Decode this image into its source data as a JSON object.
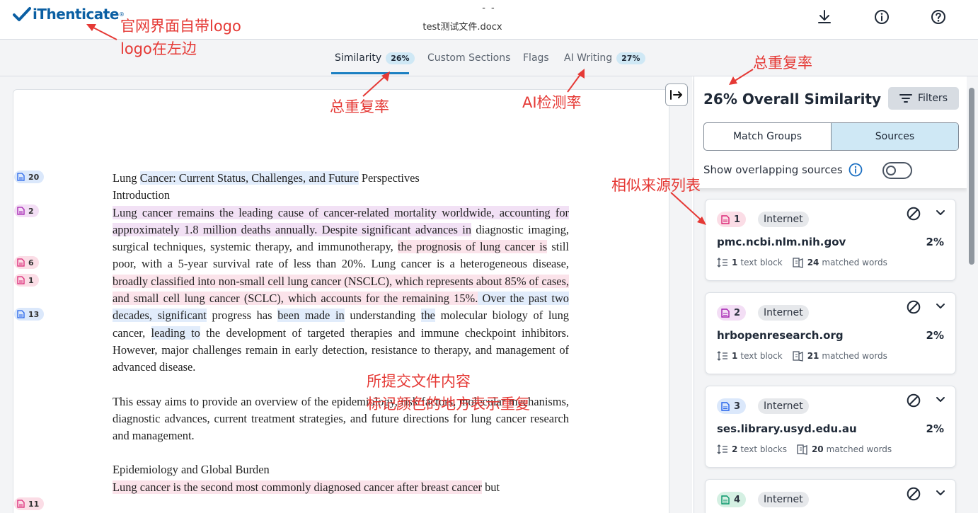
{
  "header": {
    "brand": "iThenticate",
    "doc_dashes": "- -",
    "doc_name": "test测试文件.docx",
    "icons": [
      "download-icon",
      "info-icon",
      "help-icon"
    ]
  },
  "tabs": [
    {
      "label": "Similarity",
      "badge": "26%",
      "active": true
    },
    {
      "label": "Custom Sections"
    },
    {
      "label": "Flags"
    },
    {
      "label": "AI Writing",
      "badge": "27%"
    }
  ],
  "document": {
    "markers": [
      "20",
      "2",
      "6",
      "1",
      "13",
      "11"
    ],
    "title_a": "Lung ",
    "title_b": "Cancer: Current Status, Challenges, and Future",
    "title_c": " Perspectives",
    "intro": "Introduction",
    "p1": [
      "Lung cancer remains",
      " the leading cause of cancer-related mortality worldwide, accounting for approximately 1.8 million deaths annually. Despite significant advances in",
      " diagnostic imaging, surgical techniques, systemic therapy, and immunotherapy, ",
      "the prognosis of lung cancer is",
      " still poor, with a 5-year survival rate of less than 20%. Lung cancer is a heterogeneous disease, ",
      "broadly classified into non-small cell lung cancer (NSCLC), which represents",
      " about 85% of cases, and small cell lung cancer (SCLC), which accounts for the remaining 15%.",
      " Over the past",
      " two decades, significant",
      " progress has ",
      "been made in",
      " understanding ",
      "the",
      " molecular biology of lung cancer, ",
      "leading to",
      " the development of targeted therapies and immune checkpoint inhibitors. However, major challenges remain in early detection, resistance to therapy, and management of advanced disease."
    ],
    "p2": "This essay aims to provide an overview of the epidemiology, risk factors, molecular mechanisms, diagnostic advances, current treatment strategies, and future directions for lung cancer research and management.",
    "heading2": "Epidemiology and Global Burden",
    "p3": "Lung cancer is the second most commonly diagnosed cancer after breast cancer",
    "p3_tail": " but"
  },
  "panel": {
    "overall": "26% Overall Similarity",
    "filters_label": "Filters",
    "seg_match_groups": "Match Groups",
    "seg_sources": "Sources",
    "overlap_label": "Show overlapping sources",
    "overlap_on": false
  },
  "sources": [
    {
      "num": "1",
      "type": "Internet",
      "domain": "pmc.ncbi.nlm.nih.gov",
      "pct": "2%",
      "blocks_n": "1",
      "blocks_label": "text block",
      "words_n": "24",
      "words_label": "matched words",
      "color": "#fbdde6"
    },
    {
      "num": "2",
      "type": "Internet",
      "domain": "hrbopenresearch.org",
      "pct": "2%",
      "blocks_n": "1",
      "blocks_label": "text block",
      "words_n": "21",
      "words_label": "matched words",
      "color": "#f3def5"
    },
    {
      "num": "3",
      "type": "Internet",
      "domain": "ses.library.usyd.edu.au",
      "pct": "2%",
      "blocks_n": "2",
      "blocks_label": "text blocks",
      "words_n": "20",
      "words_label": "matched words",
      "color": "#dbe8fb"
    },
    {
      "num": "4",
      "type": "Internet",
      "color": "#d5f0e3"
    }
  ],
  "annotations": {
    "logo_1": "官网界面自带logo",
    "logo_2": "logo在左边",
    "total_tab": "总重复率",
    "ai_rate": "AI检测率",
    "total_panel": "总重复率",
    "source_list": "相似来源列表",
    "content_1": "所提交文件内容",
    "content_2": "标记颜色的地方表示重复"
  },
  "colors": {
    "accent": "#1b7fc2",
    "annotation": "#e53935",
    "highlight_pink": "#fbe3ea",
    "highlight_lavender": "#f2e1f5",
    "highlight_blue": "#e1ecfb"
  }
}
